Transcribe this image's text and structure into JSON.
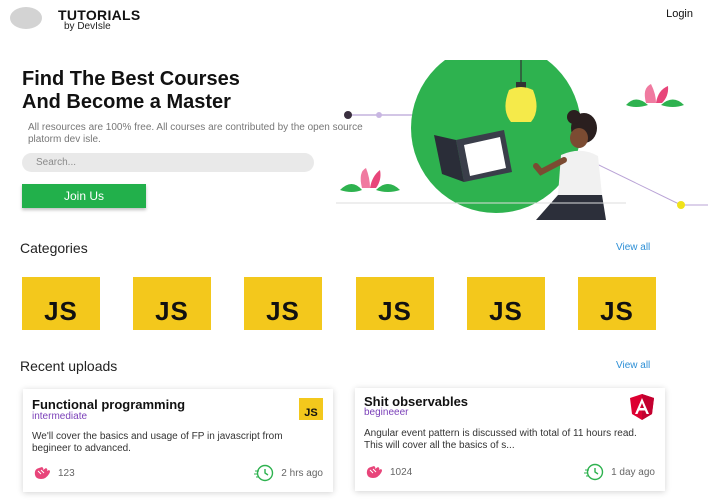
{
  "header": {
    "brand_title": "TUTORIALS",
    "brand_sub": "by DevIsle",
    "login": "Login"
  },
  "hero": {
    "title_line1": "Find The Best Courses",
    "title_line2": "And Become a Master",
    "description": "All resources are 100% free. All courses are contributed by the open source platorm dev isle.",
    "search_placeholder": "Search...",
    "join_label": "Join Us"
  },
  "categories": {
    "title": "Categories",
    "view_all": "View all",
    "items": [
      {
        "label": "JS"
      },
      {
        "label": "JS"
      },
      {
        "label": "JS"
      },
      {
        "label": "JS"
      },
      {
        "label": "JS"
      },
      {
        "label": "JS"
      }
    ]
  },
  "recent": {
    "title": "Recent uploads",
    "view_all": "View all",
    "cards": [
      {
        "title": "Functional programming",
        "level": "intermediate",
        "description": "We'll cover the basics and usage of FP in javascript from begineer to advanced.",
        "likes": "123",
        "time": "2 hrs ago",
        "badge": "JS",
        "icon": "javascript-icon"
      },
      {
        "title": "Shit observables",
        "level": "begineeer",
        "description": "Angular event pattern is discussed with total of 11 hours read. This will cover all the basics of s...",
        "likes": "1024",
        "time": "1 day ago",
        "badge": "A",
        "icon": "angular-icon"
      }
    ]
  },
  "colors": {
    "accent_green": "#22b04b",
    "js_yellow": "#f3c81c",
    "link_blue": "#2d8fd6",
    "level_purple": "#7a3fb8",
    "angular_red": "#dd0031",
    "like_pink": "#e8457a"
  }
}
